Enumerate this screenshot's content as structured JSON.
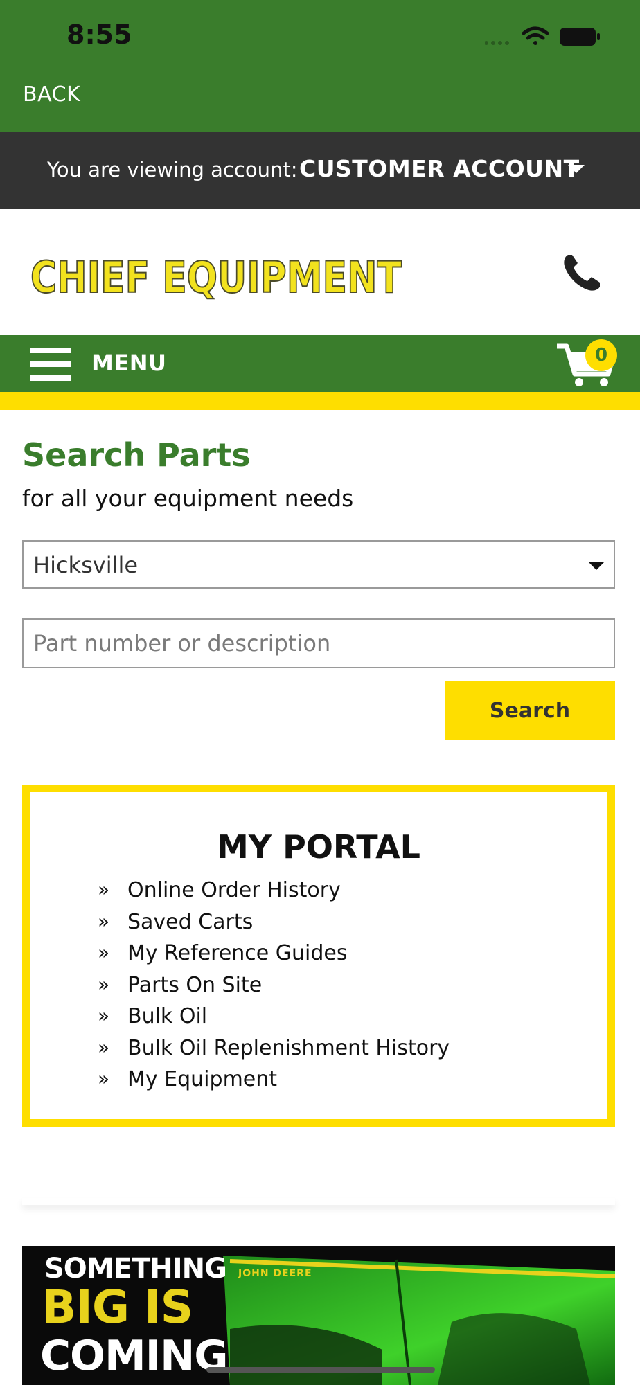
{
  "status_bar": {
    "time": "8:55"
  },
  "header": {
    "back_label": "BACK"
  },
  "account": {
    "label": "You are viewing account:",
    "value": "CUSTOMER ACCOUNT"
  },
  "logo": {
    "text": "CHIEF EQUIPMENT"
  },
  "nav": {
    "menu_label": "MENU",
    "cart_count": "0"
  },
  "search": {
    "title": "Search Parts",
    "subtitle": "for all your equipment needs",
    "location": "Hicksville",
    "placeholder": "Part number or description",
    "button_label": "Search"
  },
  "portal": {
    "title": "MY PORTAL",
    "bullet": "»",
    "items": [
      "Online Order History",
      "Saved Carts",
      "My Reference Guides",
      "Parts On Site",
      "Bulk Oil",
      "Bulk Oil Replenishment History",
      "My Equipment"
    ]
  },
  "banner": {
    "line1": "SOMETHING",
    "line2": "BIG IS",
    "line3": "COMING",
    "brand": "JOHN DEERE"
  },
  "colors": {
    "brand_green": "#3a7d2c",
    "brand_yellow": "#fede00",
    "account_bar": "#333333"
  },
  "icons": {
    "status": [
      "signal-icon",
      "wifi-icon",
      "battery-icon"
    ],
    "phone": "phone-icon",
    "menu": "hamburger-icon",
    "cart": "cart-icon",
    "select": "caret-down-icon"
  }
}
